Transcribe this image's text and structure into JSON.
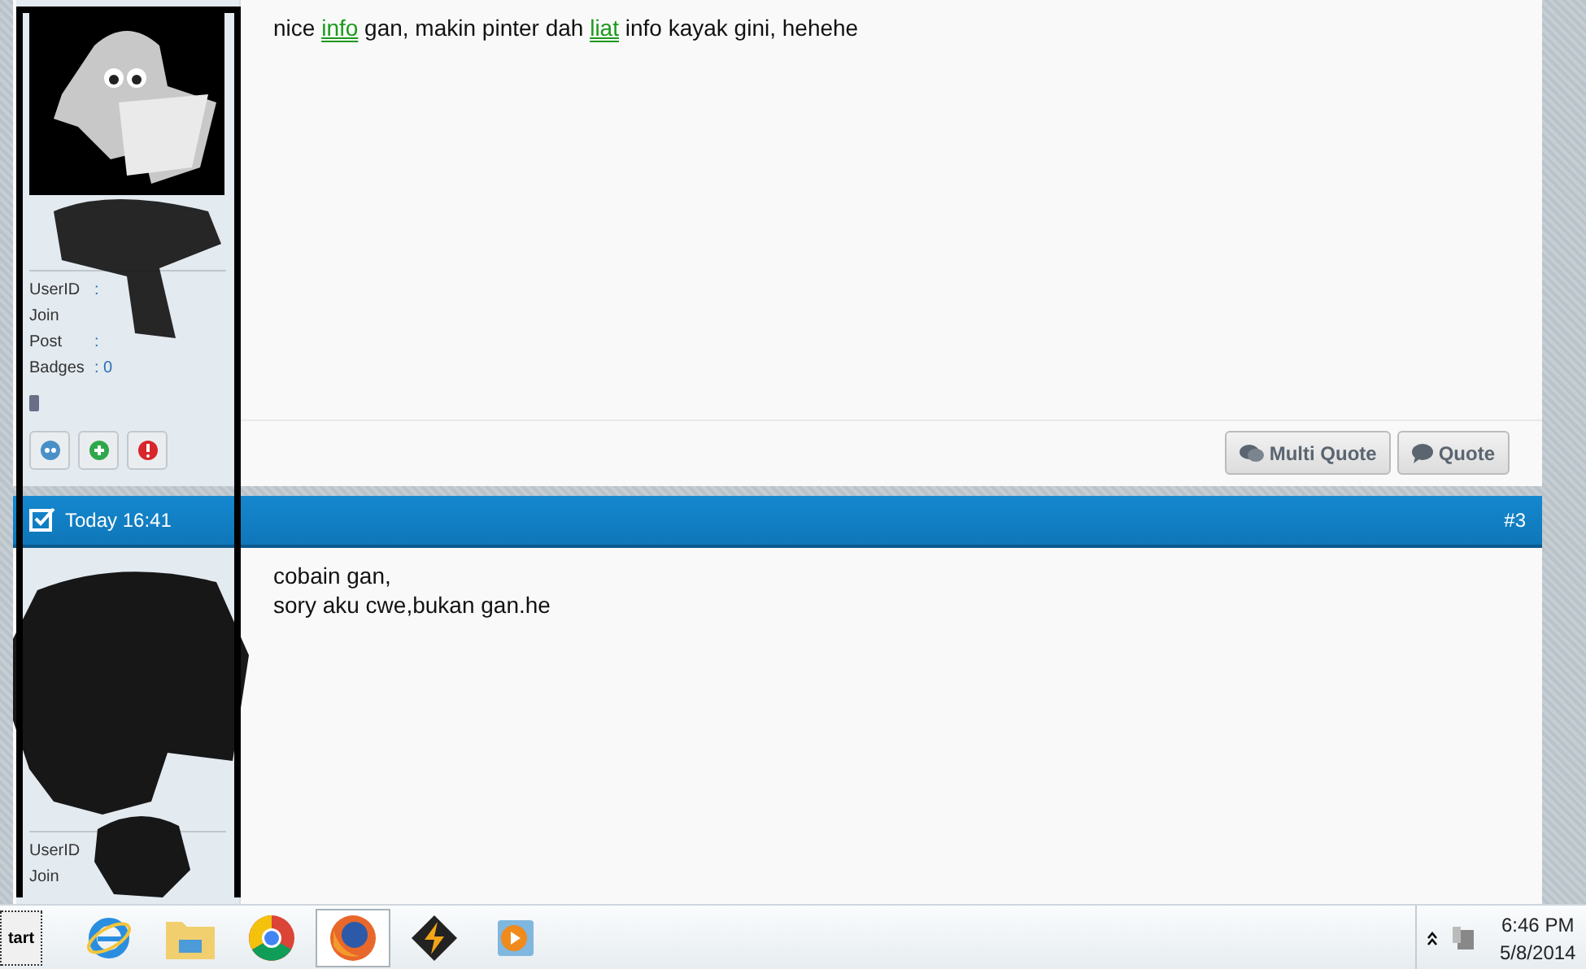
{
  "posts": [
    {
      "user": {
        "stats": [
          {
            "label": "UserID",
            "value": ":"
          },
          {
            "label": "Join"
          },
          {
            "label": "Post",
            "value": ":"
          },
          {
            "label": "Badges",
            "value": ": 0"
          }
        ],
        "actions": [
          {
            "kind": "profile"
          },
          {
            "kind": "add"
          },
          {
            "kind": "report"
          }
        ]
      },
      "message": [
        {
          "kind": "text",
          "text": "nice "
        },
        {
          "kind": "link",
          "text": "info"
        },
        {
          "kind": "text",
          "text": " gan, makin pinter dah "
        },
        {
          "kind": "link",
          "text": "liat"
        },
        {
          "kind": "text",
          "text": " info kayak gini, hehehe"
        }
      ],
      "buttons": [
        {
          "kind": "multi",
          "label": "Multi Quote"
        },
        {
          "kind": "single",
          "label": "Quote"
        }
      ]
    },
    {
      "header": {
        "date": "Today 16:41",
        "number": "#3"
      },
      "user": {
        "stats": [
          {
            "label": "UserID"
          },
          {
            "label": "Join"
          }
        ]
      },
      "lines": [
        "cobain gan,",
        "sory aku cwe,bukan gan.he"
      ]
    }
  ],
  "taskbar": {
    "start": "tart",
    "apps": [
      {
        "kind": "ie",
        "selected": false
      },
      {
        "kind": "folder",
        "selected": false
      },
      {
        "kind": "chrome",
        "selected": false
      },
      {
        "kind": "firefox",
        "selected": true
      },
      {
        "kind": "winamp",
        "selected": false
      },
      {
        "kind": "player",
        "selected": false
      }
    ],
    "time": "6:46 PM",
    "date": "5/8/2014"
  }
}
